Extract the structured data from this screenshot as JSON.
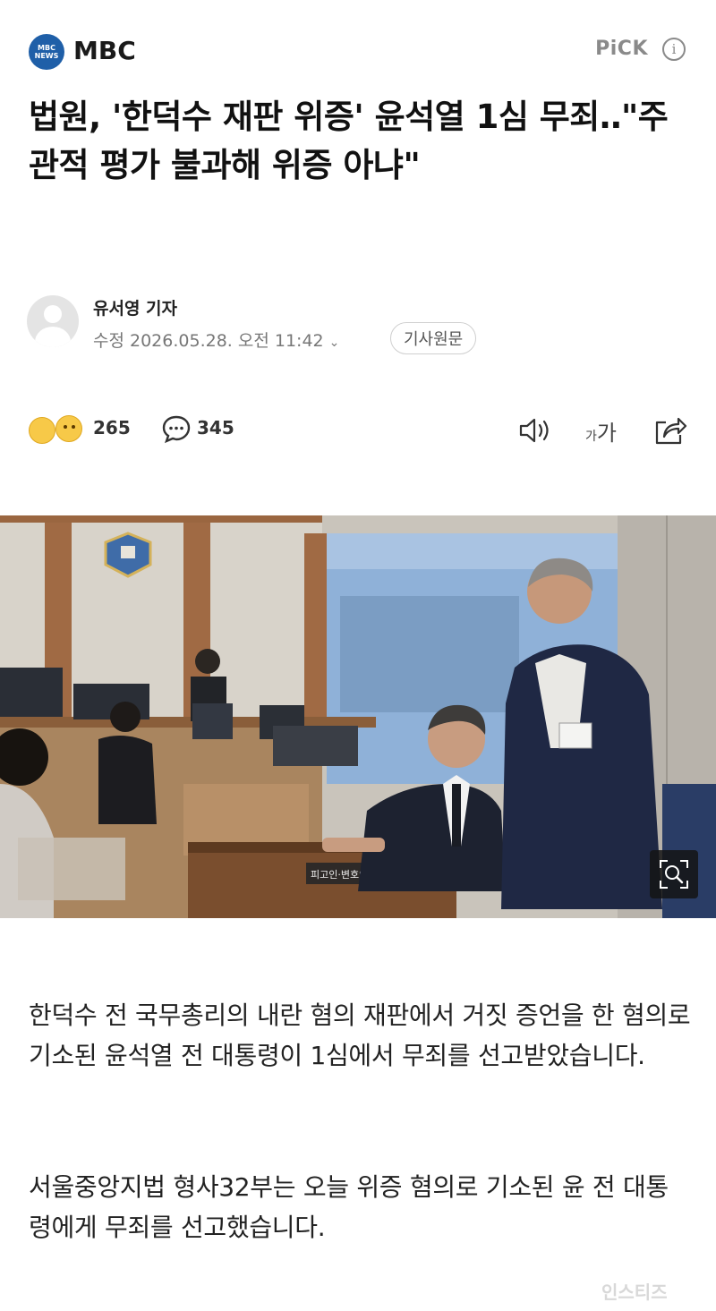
{
  "press": {
    "logo_line1": "MBC",
    "logo_line2": "NEWS",
    "name": "MBC",
    "pick_label": "PiCK",
    "info_label": "i"
  },
  "article": {
    "headline": "법원, '한덕수 재판 위증' 윤석열 1심 무죄‥\"주관적 평가 불과해 위증 아냐\"",
    "author": "유서영 기자",
    "date": "수정 2026.05.28. 오전 11:42",
    "original_button": "기사원문",
    "reaction_count": "265",
    "comment_count": "345",
    "font_small": "가",
    "font_large": "가",
    "photo_nameplate": "피고인·변호인석",
    "paragraphs": [
      "한덕수 전 국무총리의 내란 혐의 재판에서 거짓 증언을 한 혐의로 기소된 윤석열 전 대통령이 1심에서 무죄를 선고받았습니다.",
      "서울중앙지법 형사32부는 오늘 위증 혐의로 기소된 윤 전 대통령에게 무죄를 선고했습니다."
    ]
  },
  "watermark": "인스티즈",
  "icons": [
    "info-icon",
    "reaction-emoji-icon",
    "comment-icon",
    "speaker-icon",
    "font-size-icon",
    "share-icon",
    "zoom-icon",
    "avatar-icon"
  ]
}
